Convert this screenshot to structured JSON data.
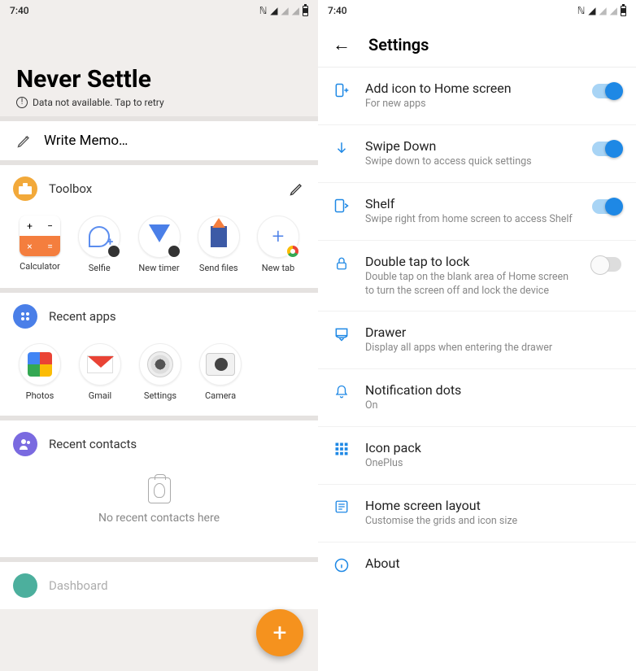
{
  "status": {
    "time": "7:40"
  },
  "left": {
    "hero_title": "Never Settle",
    "retry_text": "Data not available. Tap to retry",
    "memo_placeholder": "Write Memo…",
    "toolbox": {
      "title": "Toolbox",
      "apps": [
        {
          "label": "Calculator"
        },
        {
          "label": "Selfie"
        },
        {
          "label": "New timer"
        },
        {
          "label": "Send files"
        },
        {
          "label": "New tab"
        }
      ]
    },
    "recent_apps": {
      "title": "Recent apps",
      "apps": [
        {
          "label": "Photos"
        },
        {
          "label": "Gmail"
        },
        {
          "label": "Settings"
        },
        {
          "label": "Camera"
        }
      ]
    },
    "recent_contacts": {
      "title": "Recent contacts",
      "empty": "No recent contacts here"
    },
    "dashboard_label": "Dashboard"
  },
  "right": {
    "title": "Settings",
    "items": [
      {
        "title": "Add icon to Home screen",
        "sub": "For new apps",
        "toggle": "on",
        "icon": "add-home"
      },
      {
        "title": "Swipe Down",
        "sub": "Swipe down to access quick settings",
        "toggle": "on",
        "icon": "arrow-down"
      },
      {
        "title": "Shelf",
        "sub": "Swipe right from home screen to access Shelf",
        "toggle": "on",
        "icon": "shelf"
      },
      {
        "title": "Double tap to lock",
        "sub": "Double tap on the blank area of Home screen to turn the screen off and lock the device",
        "toggle": "off",
        "icon": "lock"
      },
      {
        "title": "Drawer",
        "sub": "Display all apps when entering the drawer",
        "icon": "drawer"
      },
      {
        "title": "Notification dots",
        "sub": "On",
        "icon": "bell"
      },
      {
        "title": "Icon pack",
        "sub": "OnePlus",
        "icon": "grid"
      },
      {
        "title": "Home screen layout",
        "sub": "Customise the grids and icon size",
        "icon": "layout"
      },
      {
        "title": "About",
        "icon": "info"
      }
    ]
  }
}
